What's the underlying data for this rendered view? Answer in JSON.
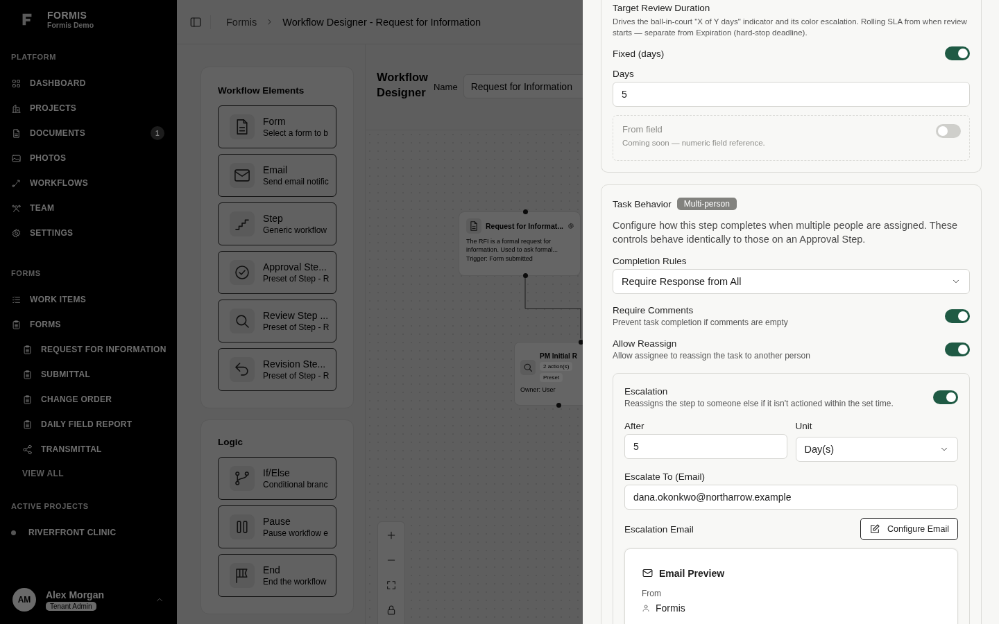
{
  "sidebar": {
    "brand": {
      "name": "FORMIS",
      "subtitle": "Formis Demo"
    },
    "sections": [
      {
        "label": "PLATFORM",
        "items": [
          {
            "label": "DASHBOARD"
          },
          {
            "label": "PROJECTS"
          },
          {
            "label": "DOCUMENTS",
            "badge": "1"
          },
          {
            "label": "PHOTOS"
          },
          {
            "label": "WORKFLOWS"
          },
          {
            "label": "TEAM"
          },
          {
            "label": "SETTINGS"
          }
        ]
      },
      {
        "label": "FORMS",
        "items": [
          {
            "label": "WORK ITEMS"
          },
          {
            "label": "FORMS",
            "children": [
              {
                "label": "REQUEST FOR INFORMATION"
              },
              {
                "label": "SUBMITTAL"
              },
              {
                "label": "CHANGE ORDER"
              },
              {
                "label": "DAILY FIELD REPORT"
              },
              {
                "label": "TRANSMITTAL"
              }
            ]
          }
        ],
        "link": "VIEW ALL"
      },
      {
        "label": "ACTIVE PROJECTS",
        "items": [
          {
            "label": "RIVERFRONT CLINIC"
          }
        ]
      }
    ],
    "user": {
      "initials": "AM",
      "name": "Alex Morgan",
      "role": "Tenant Admin"
    }
  },
  "breadcrumb": [
    "Formis",
    "Workflow Designer - Request for Information"
  ],
  "palette": [
    {
      "title": "Workflow Elements",
      "items": [
        {
          "title": "Form",
          "description": "Select a form to b"
        },
        {
          "title": "Email",
          "description": "Send email notific"
        },
        {
          "title": "Step",
          "description": "Generic workflow"
        },
        {
          "title": "Approval Ste...",
          "description": "Preset of Step - R"
        },
        {
          "title": "Review Step ...",
          "description": "Preset of Step - R"
        },
        {
          "title": "Revision Ste...",
          "description": "Preset of Step - R"
        }
      ]
    },
    {
      "title": "Logic",
      "items": [
        {
          "title": "If/Else",
          "description": "Conditional branc"
        },
        {
          "title": "Pause",
          "description": "Pause workflow e"
        },
        {
          "title": "End",
          "description": "End the workflow"
        }
      ]
    }
  ],
  "canvas": {
    "title": "Workflow Designer",
    "name_label": "Name",
    "name_value": "Request for Information",
    "nodes": [
      {
        "kind": "trigger",
        "title": "Request for Informat...",
        "description": "The RFI is a formal request for information. Used to ask formal...",
        "meta": "Trigger: Form submitted"
      },
      {
        "kind": "step",
        "title": "PM Initial R",
        "tags": [
          "2 action(s)",
          "Preset"
        ],
        "owner": "Owner: User"
      }
    ]
  },
  "duration": {
    "title": "Target Review Duration",
    "description": "Drives the ball-in-court \"X of Y days\" indicator and its color escalation. Rolling SLA from when review starts — separate from Expiration (hard-stop deadline).",
    "fixed": {
      "label": "Fixed (days)",
      "on": true
    },
    "days": {
      "label": "Days",
      "value": "5"
    },
    "from_field": {
      "label": "From field",
      "note": "Coming soon — numeric field reference.",
      "on": false,
      "disabled": true
    }
  },
  "task_behavior": {
    "title": "Task Behavior",
    "badge": "Multi-person",
    "description": "Configure how this step completes when multiple people are assigned. These controls behave identically to those on an Approval Step.",
    "completion": {
      "label": "Completion Rules",
      "value": "Require Response from All"
    },
    "toggles": [
      {
        "label": "Require Comments",
        "description": "Prevent task completion if comments are empty",
        "on": true
      },
      {
        "label": "Allow Reassign",
        "description": "Allow assignee to reassign the task to another person",
        "on": true
      }
    ],
    "escalation": {
      "label": "Escalation",
      "description": "Reassigns the step to someone else if it isn't actioned within the set time.",
      "on": true,
      "after": {
        "label": "After",
        "value": "5"
      },
      "unit": {
        "label": "Unit",
        "value": "Day(s)"
      },
      "escalate_to": {
        "label": "Escalate To (Email)",
        "value": "dana.okonkwo@northarrow.example"
      },
      "email": {
        "label": "Escalation Email",
        "button": "Configure Email",
        "preview": {
          "title": "Email Preview",
          "from_label": "From",
          "from": "Formis"
        }
      }
    }
  }
}
